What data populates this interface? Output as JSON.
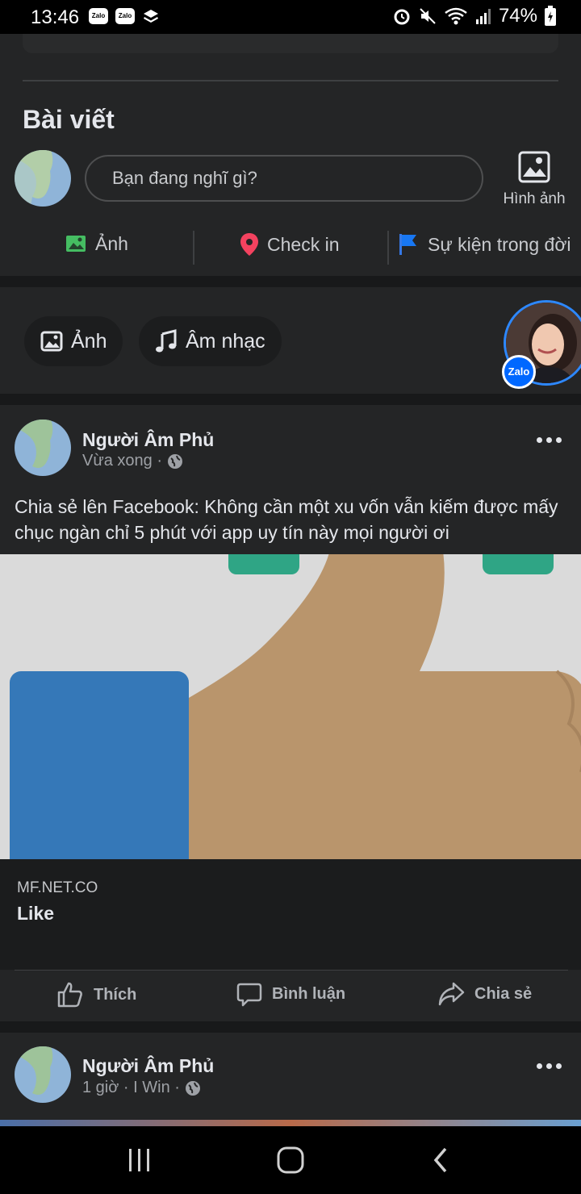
{
  "status_bar": {
    "time": "13:46",
    "apps": [
      "Zalo",
      "Zalo"
    ],
    "battery": "74%"
  },
  "composer": {
    "section_title": "Bài viết",
    "placeholder": "Bạn đang nghĩ gì?",
    "photo_label": "Hình ảnh",
    "actions": [
      {
        "label": "Ảnh",
        "icon": "photo-icon",
        "color": "#45bd62"
      },
      {
        "label": "Check in",
        "icon": "location-pin-icon",
        "color": "#f3425f"
      },
      {
        "label": "Sự kiện trong đời",
        "icon": "flag-icon",
        "color": "#1877f2"
      }
    ]
  },
  "stories": {
    "pills": [
      {
        "label": "Ảnh",
        "icon": "photo-icon"
      },
      {
        "label": "Âm nhạc",
        "icon": "music-note-icon"
      }
    ],
    "badge": "Zalo"
  },
  "post1": {
    "author": "Người Âm Phủ",
    "time": "Vừa xong ·",
    "text": "Chia sẻ lên Facebook: Không cần một xu vốn vẫn kiếm được mấy chục ngàn chỉ 5 phút với app uy tín này mọi người ơi",
    "link_domain": "MF.NET.CO",
    "link_title": "Like",
    "actions": {
      "like": "Thích",
      "comment": "Bình luận",
      "share": "Chia sẻ"
    }
  },
  "post2": {
    "author": "Người Âm Phủ",
    "time": "1 giờ · I Win ·"
  },
  "colors": {
    "background": "#18191a",
    "card": "#242526",
    "accent_blue": "#2d88ff",
    "zalo_blue": "#0068ff"
  }
}
